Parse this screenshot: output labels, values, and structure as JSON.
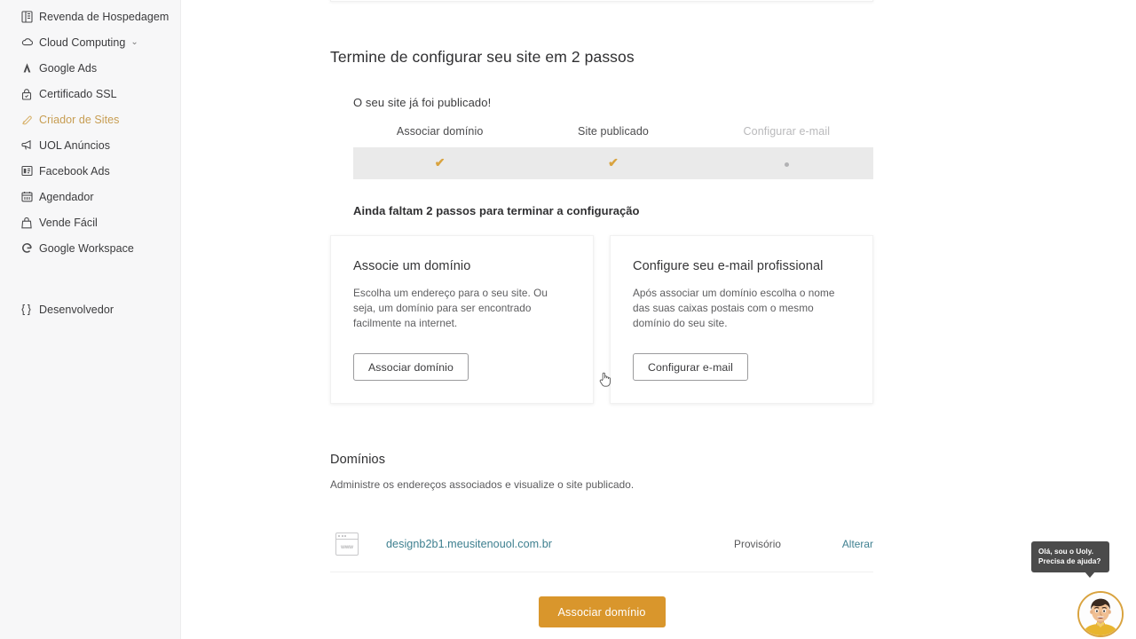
{
  "sidebar": {
    "items": [
      {
        "label": "Revenda de Hospedagem",
        "icon": "server-icon",
        "active": false,
        "chevron": false
      },
      {
        "label": "Cloud Computing",
        "icon": "cloud-icon",
        "active": false,
        "chevron": true
      },
      {
        "label": "Google Ads",
        "icon": "google-ads-icon",
        "active": false,
        "chevron": false
      },
      {
        "label": "Certificado SSL",
        "icon": "lock-icon",
        "active": false,
        "chevron": false
      },
      {
        "label": "Criador de Sites",
        "icon": "site-builder-icon",
        "active": true,
        "chevron": false
      },
      {
        "label": "UOL Anúncios",
        "icon": "megaphone-icon",
        "active": false,
        "chevron": false
      },
      {
        "label": "Facebook Ads",
        "icon": "facebook-ads-icon",
        "active": false,
        "chevron": false
      },
      {
        "label": "Agendador",
        "icon": "calendar-icon",
        "active": false,
        "chevron": false
      },
      {
        "label": "Vende Fácil",
        "icon": "bag-icon",
        "active": false,
        "chevron": false
      },
      {
        "label": "Google Workspace",
        "icon": "google-g-icon",
        "active": false,
        "chevron": false
      }
    ],
    "footer_item": {
      "label": "Desenvolvedor",
      "icon": "code-icon"
    },
    "chevron_glyph": "⌄",
    "active_color": "#c79d52"
  },
  "main": {
    "page_title": "Termine de configurar seu site em 2 passos",
    "published_message": "O seu site já foi publicado!",
    "steps": [
      {
        "label": "Associar domínio",
        "state": "done",
        "mark": "✔"
      },
      {
        "label": "Site publicado",
        "state": "done",
        "mark": "✔"
      },
      {
        "label": "Configurar e-mail",
        "state": "pending",
        "mark": ""
      }
    ],
    "remaining_title": "Ainda faltam 2 passos para terminar a configuração",
    "cards": [
      {
        "title": "Associe um domínio",
        "description": "Escolha um endereço para o seu site. Ou seja, um domínio para ser encontrado facilmente na internet.",
        "button": "Associar domínio"
      },
      {
        "title": "Configure seu e-mail profissional",
        "description": "Após associar um domínio escolha o nome das suas caixas postais com o mesmo domínio do seu site.",
        "button": "Configurar e-mail"
      }
    ],
    "domains": {
      "title": "Domínios",
      "description": "Administre os endereços associados e visualize o site publicado.",
      "icon_label": "www",
      "rows": [
        {
          "name": "designb2b1.meusitenouol.com.br",
          "status": "Provisório",
          "action": "Alterar"
        }
      ]
    },
    "cta_button": "Associar domínio",
    "accent_color": "#d9962c",
    "link_color": "#3d7f8f",
    "check_color": "#d9a33f"
  },
  "chat_widget": {
    "line1": "Olá, sou o Uoly.",
    "line2": "Precisa de ajuda?",
    "avatar_name": "uoly-avatar"
  }
}
